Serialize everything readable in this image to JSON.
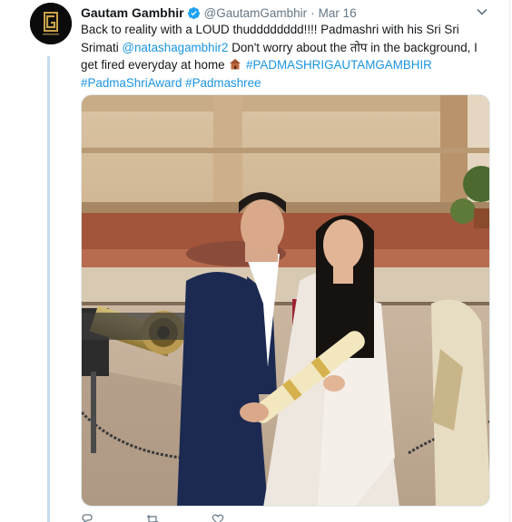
{
  "tweet": {
    "author_name": "Gautam Gambhir",
    "handle": "@GautamGambhir",
    "separator": "·",
    "timestamp": "Mar 16",
    "text_part1": "Back to reality with a LOUD thudddddddd!!!! Padmashri with his Sri Sri Srimati ",
    "mention": "@natashagambhir2",
    "text_part2": " Don't worry about the तोप in the background, I get fired everyday at home ",
    "hashtag1": "#PADMASHRIGAUTAMGAMBHIR",
    "hashtag2": "#PadmaShriAward",
    "hashtag3": "#Padmashree"
  },
  "icons": {
    "verified": "verified-badge-icon",
    "caret": "chevron-down-icon",
    "emoji": "house-emoji-icon",
    "reply": "reply-icon",
    "retweet": "retweet-icon",
    "like": "heart-icon"
  },
  "colors": {
    "link": "#1b95e0",
    "verified": "#1da1f2",
    "muted": "#657786",
    "thread_line": "#c5dcee"
  }
}
